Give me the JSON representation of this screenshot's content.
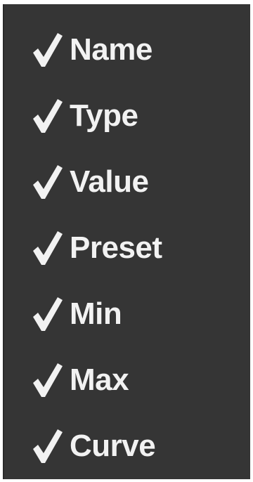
{
  "menu": {
    "items": [
      {
        "label": "Name",
        "checked": true,
        "icon": "checkmark-icon"
      },
      {
        "label": "Type",
        "checked": true,
        "icon": "checkmark-icon"
      },
      {
        "label": "Value",
        "checked": true,
        "icon": "checkmark-icon"
      },
      {
        "label": "Preset",
        "checked": true,
        "icon": "checkmark-icon"
      },
      {
        "label": "Min",
        "checked": true,
        "icon": "checkmark-icon"
      },
      {
        "label": "Max",
        "checked": true,
        "icon": "checkmark-icon"
      },
      {
        "label": "Curve",
        "checked": true,
        "icon": "checkmark-icon"
      }
    ],
    "colors": {
      "background": "#353535",
      "text": "#f2f2f2"
    }
  }
}
